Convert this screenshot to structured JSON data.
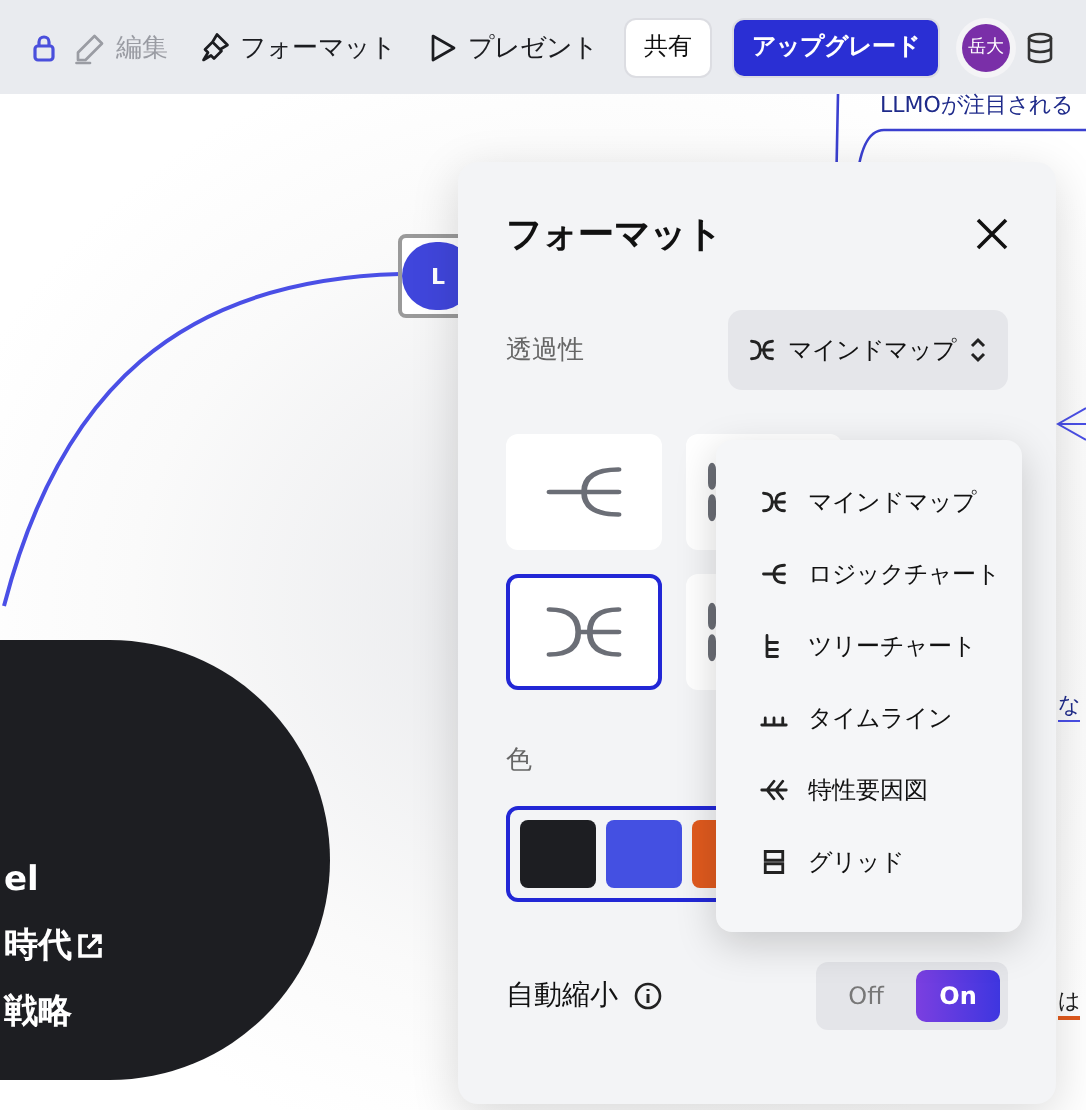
{
  "toolbar": {
    "locked": true,
    "tools": [
      {
        "kind": "edit",
        "label": "編集",
        "disabled": true
      },
      {
        "kind": "format",
        "label": "フォーマット",
        "disabled": false
      },
      {
        "kind": "present",
        "label": "プレゼント",
        "disabled": false
      }
    ],
    "buttons": [
      {
        "kind": "plain",
        "label": "共有"
      },
      {
        "kind": "primary",
        "label": "アップグレード"
      }
    ],
    "avatar": "岳大"
  },
  "canvas": {
    "top_node": "LLMOが注目される",
    "center_node": "L",
    "side_labels": [
      "な",
      "は"
    ],
    "dark_node_lines": [
      "el",
      "時代",
      "戦略"
    ]
  },
  "format_panel": {
    "title": "フォーマット",
    "style_label": "透過性",
    "style_value": {
      "kind": "mindmap",
      "label": "マインドマップ"
    },
    "layouts": [
      {
        "kind": "logic",
        "selected": false
      },
      {
        "kind": "other",
        "selected": false
      },
      {
        "kind": "mindmap",
        "selected": true
      },
      {
        "kind": "other",
        "selected": false
      }
    ],
    "color_label": "色",
    "colors": [
      {
        "color": "#1d1e22"
      },
      {
        "color": "#4450e2"
      },
      {
        "color": "#e05a1e"
      }
    ],
    "auto_shrink": {
      "label": "自動縮小",
      "options": [
        {
          "label": "Off",
          "selected": false
        },
        {
          "label": "On",
          "selected": true
        }
      ]
    }
  },
  "style_menu": [
    {
      "kind": "mindmap",
      "label": "マインドマップ"
    },
    {
      "kind": "logic",
      "label": "ロジックチャート"
    },
    {
      "kind": "tree",
      "label": "ツリーチャート"
    },
    {
      "kind": "timeline",
      "label": "タイムライン"
    },
    {
      "kind": "fishbone",
      "label": "特性要因図"
    },
    {
      "kind": "grid",
      "label": "グリッド"
    }
  ]
}
